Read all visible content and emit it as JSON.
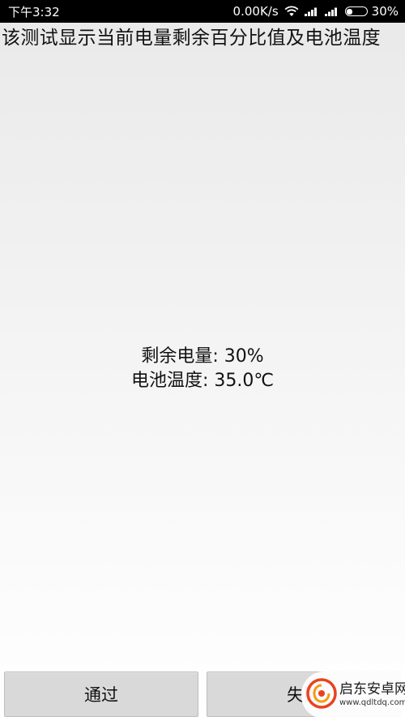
{
  "status_bar": {
    "time": "下午3:32",
    "net_speed": "0.00K/s",
    "battery_percent_text": "30%",
    "battery_level": 0.3,
    "icons": [
      "wifi-icon",
      "signal-icon",
      "signal-icon",
      "battery-icon"
    ]
  },
  "page": {
    "title": "该测试显示当前电量剩余百分比值及电池温度"
  },
  "readings": {
    "remaining_battery": "剩余电量: 30%",
    "battery_temperature": "电池温度: 35.0℃"
  },
  "buttons": {
    "pass_label": "通过",
    "fail_label": "失败"
  },
  "watermark": {
    "title": "启东安卓网",
    "url": "www.qdltdq.com",
    "icon": "app-logo-icon",
    "brand_color": "#e8431e"
  }
}
